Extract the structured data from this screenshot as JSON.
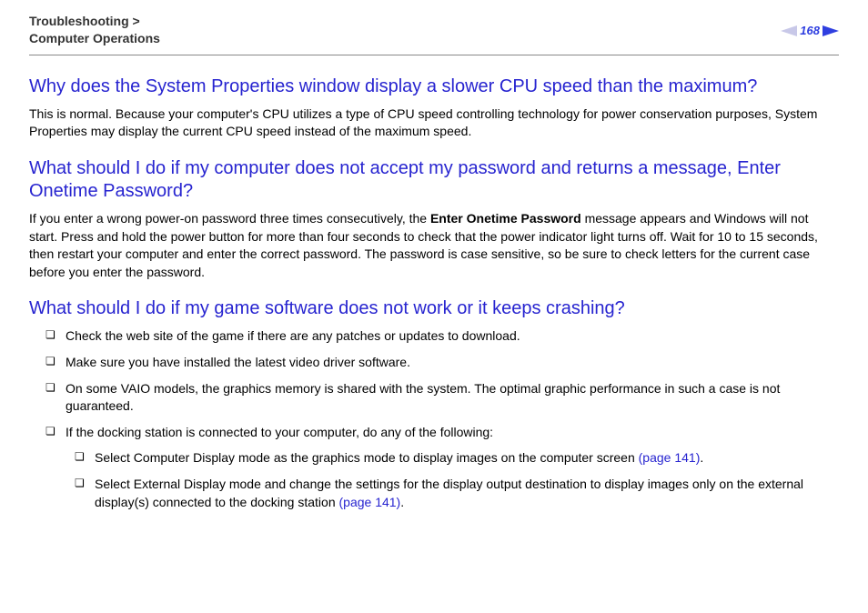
{
  "header": {
    "breadcrumb_line1": "Troubleshooting >",
    "breadcrumb_line2": "Computer Operations",
    "page_number": "168"
  },
  "sections": {
    "s1": {
      "heading": "Why does the System Properties window display a slower CPU speed than the maximum?",
      "body": "This is normal. Because your computer's CPU utilizes a type of CPU speed controlling technology for power conservation purposes, System Properties may display the current CPU speed instead of the maximum speed."
    },
    "s2": {
      "heading": "What should I do if my computer does not accept my password and returns a message, Enter Onetime Password?",
      "body_pre": "If you enter a wrong power-on password three times consecutively, the ",
      "body_bold": "Enter Onetime Password",
      "body_post": " message appears and Windows will not start. Press and hold the power button for more than four seconds to check that the power indicator light turns off. Wait for 10 to 15 seconds, then restart your computer and enter the correct password. The password is case sensitive, so be sure to check letters for the current case before you enter the password."
    },
    "s3": {
      "heading": "What should I do if my game software does not work or it keeps crashing?",
      "bullets": {
        "b1": "Check the web site of the game if there are any patches or updates to download.",
        "b2": "Make sure you have installed the latest video driver software.",
        "b3": "On some VAIO models, the graphics memory is shared with the system. The optimal graphic performance in such a case is not guaranteed.",
        "b4": "If the docking station is connected to your computer, do any of the following:",
        "b4a_text": "Select Computer Display mode as the graphics mode to display images on the computer screen ",
        "b4a_link": "(page 141)",
        "b4a_suffix": ".",
        "b4b_text": "Select External Display mode and change the settings for the display output destination to display images only on the external display(s) connected to the docking station ",
        "b4b_link": "(page 141)",
        "b4b_suffix": "."
      }
    }
  }
}
